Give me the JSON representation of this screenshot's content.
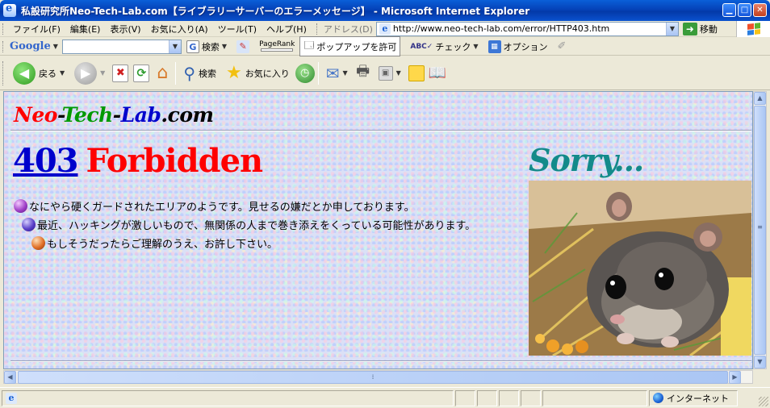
{
  "window": {
    "title": "私設研究所Neo-Tech-Lab.com【ライブラリーサーバーのエラーメッセージ】 - Microsoft Internet Explorer"
  },
  "menu": {
    "items": [
      "ファイル(F)",
      "編集(E)",
      "表示(V)",
      "お気に入り(A)",
      "ツール(T)",
      "ヘルプ(H)"
    ]
  },
  "address": {
    "label": "アドレス(D)",
    "url": "http://www.neo-tech-lab.com/error/HTTP403.htm",
    "go_label": "移動"
  },
  "google_bar": {
    "logo": "Google",
    "search_label": "検索",
    "pagerank_label": "PageRank",
    "popup_label": "ポップアップを許可",
    "spell_label": "チェック",
    "options_label": "オプション"
  },
  "nav_toolbar": {
    "back_label": "戻る",
    "search_label": "検索",
    "favorites_label": "お気に入り"
  },
  "page": {
    "site_name": {
      "neo": "Neo",
      "dash1": "-",
      "tech": "Tech",
      "dash2": "-",
      "lab": "Lab",
      "com": ".com"
    },
    "error_code": "403",
    "error_word": "Forbidden",
    "sorry": "Sorry...",
    "lines": [
      "なにやら硬くガードされたエリアのようです。見せるの嫌だとか申しております。",
      "最近、ハッキングが激しいもので、無関係の人まで巻き添えをくっている可能性があります。",
      "もしそうだったらご理解のうえ、お許し下さい。"
    ]
  },
  "status_bar": {
    "zone": "インターネット"
  },
  "colors": {
    "neo": "#ff0000",
    "tech": "#009900",
    "lab": "#0000cc",
    "com": "#000000",
    "code_link": "#0000cc",
    "forbidden": "#ff0000",
    "sorry": "#138a8a"
  },
  "icons": [
    "ie-logo-icon",
    "minimize-icon",
    "maximize-icon",
    "close-icon",
    "back-icon",
    "forward-icon",
    "stop-icon",
    "refresh-icon",
    "home-icon",
    "search-icon",
    "favorites-star-icon",
    "history-icon",
    "mail-icon",
    "print-icon",
    "edit-icon",
    "messenger-icon",
    "research-icon",
    "windows-flag-icon",
    "globe-icon"
  ]
}
